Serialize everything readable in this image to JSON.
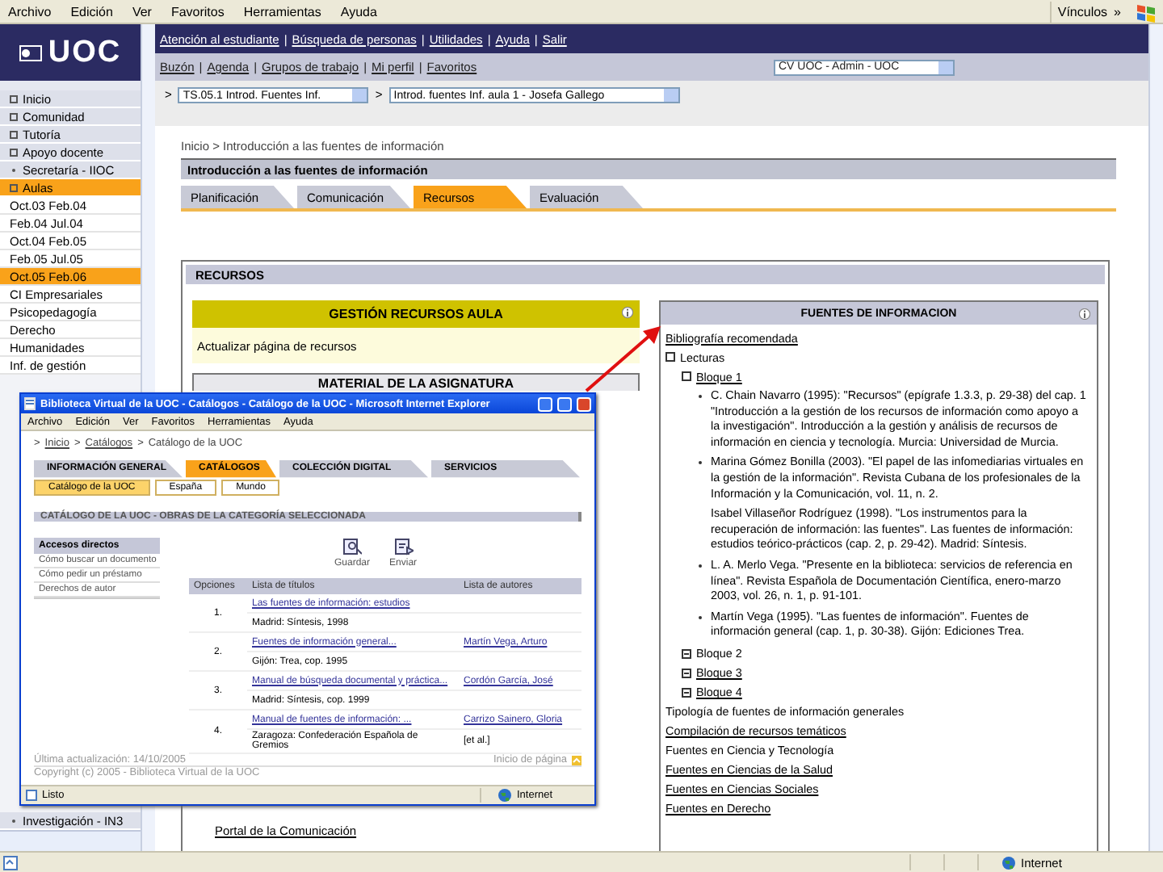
{
  "browser": {
    "menu": [
      "Archivo",
      "Edición",
      "Ver",
      "Favoritos",
      "Herramientas",
      "Ayuda"
    ],
    "links_label": "Vínculos",
    "links_chevron": "»",
    "zone": "Internet"
  },
  "sidebar": {
    "logo": "UOC",
    "items": [
      {
        "label": "Inicio",
        "kind": "section",
        "selected": false
      },
      {
        "label": "Comunidad",
        "kind": "section",
        "selected": false
      },
      {
        "label": "Tutoría",
        "kind": "section",
        "selected": false
      },
      {
        "label": "Apoyo docente",
        "kind": "section",
        "selected": false
      },
      {
        "label": "Secretaría - IIOC",
        "kind": "link",
        "selected": false
      },
      {
        "label": "Aulas",
        "kind": "section",
        "selected": true
      },
      {
        "label": "Oct.03 Feb.04",
        "kind": "term",
        "selected": false
      },
      {
        "label": "Feb.04 Jul.04",
        "kind": "term",
        "selected": false
      },
      {
        "label": "Oct.04 Feb.05",
        "kind": "term",
        "selected": false
      },
      {
        "label": "Feb.05 Jul.05",
        "kind": "term",
        "selected": false
      },
      {
        "label": "Oct.05 Feb.06",
        "kind": "term",
        "selected": true
      },
      {
        "label": "CI Empresariales",
        "kind": "term",
        "selected": false
      },
      {
        "label": "Psicopedagogía",
        "kind": "term",
        "selected": false
      },
      {
        "label": "Derecho",
        "kind": "term",
        "selected": false
      },
      {
        "label": "Humanidades",
        "kind": "term",
        "selected": false
      },
      {
        "label": "Inf. de gestión",
        "kind": "term",
        "selected": false
      }
    ],
    "bottom_item": {
      "label": "Investigación - IN3",
      "kind": "link",
      "selected": false
    }
  },
  "top_links": [
    "Atención al estudiante",
    "Búsqueda de personas",
    "Utilidades",
    "Ayuda",
    "Salir"
  ],
  "secondary_links": [
    "Buzón",
    "Agenda",
    "Grupos de trabajo",
    "Mi perfil",
    "Favoritos"
  ],
  "nav_separator": "|",
  "select_marker": ">",
  "profile_select": "CV UOC - Admin - UOC",
  "course_selects": [
    "TS.05.1 Introd. Fuentes Inf.",
    "Introd. fuentes Inf. aula 1 - Josefa Gallego"
  ],
  "breadcrumb": "Inicio > Introducción a las fuentes de información",
  "course_title": "Introducción a las fuentes de información",
  "tabs": [
    {
      "label": "Planificación",
      "selected": false
    },
    {
      "label": "Comunicación",
      "selected": false
    },
    {
      "label": "Recursos",
      "selected": true
    },
    {
      "label": "Evaluación",
      "selected": false
    }
  ],
  "resources": {
    "title": "RECURSOS",
    "management": {
      "title": "GESTIÓN RECURSOS AULA",
      "link": "Actualizar página de recursos"
    },
    "material": {
      "title": "MATERIAL DE LA ASIGNATURA"
    },
    "bottom_link": "Portal de la Comunicación",
    "sources": {
      "title": "FUENTES DE INFORMACION",
      "tree": [
        {
          "kind": "entry",
          "label": "Bibliografía recomendada",
          "link": true
        },
        {
          "kind": "folder",
          "label": "Lecturas",
          "link": false,
          "expanded": true,
          "children": [
            {
              "kind": "folder",
              "label": "Bloque 1",
              "link": true,
              "expanded": true,
              "children": [
                {
                  "kind": "reference",
                  "bullet": true,
                  "text": "C. Chain Navarro (1995): \"Recursos\" (epígrafe 1.3.3, p. 29-38) del cap. 1 \"Introducción a la gestión de los recursos de información como apoyo a la investigación\". Introducción a la gestión y análisis de recursos de información en ciencia y tecnología. Murcia: Universidad de Murcia."
                },
                {
                  "kind": "reference",
                  "bullet": true,
                  "text": "Marina Gómez Bonilla (2003). \"El papel de las infomediarias virtuales en la gestión de la información\". Revista Cubana de los profesionales de la Información y la Comunicación, vol. 11, n. 2."
                },
                {
                  "kind": "reference",
                  "bullet": false,
                  "text": "Isabel Villaseñor Rodríguez (1998). \"Los instrumentos para la recuperación de información: las fuentes\". Las fuentes de información: estudios teórico-prácticos (cap. 2, p. 29-42). Madrid: Síntesis."
                },
                {
                  "kind": "reference",
                  "bullet": true,
                  "text": "L. A. Merlo Vega. \"Presente en la biblioteca: servicios de referencia en línea\". Revista Española de Documentación Científica, enero-marzo 2003, vol. 26, n. 1, p. 91-101."
                },
                {
                  "kind": "reference",
                  "bullet": true,
                  "text": "Martín Vega (1995). \"Las fuentes de información\". Fuentes de información general (cap. 1, p. 30-38). Gijón: Ediciones Trea."
                }
              ]
            },
            {
              "kind": "folder",
              "label": "Bloque 2",
              "link": false,
              "expanded": false
            },
            {
              "kind": "folder",
              "label": "Bloque 3",
              "link": true,
              "expanded": false
            },
            {
              "kind": "folder",
              "label": "Bloque 4",
              "link": true,
              "expanded": false
            }
          ]
        },
        {
          "kind": "entry",
          "label": "Tipología de fuentes de información generales",
          "link": false
        },
        {
          "kind": "entry",
          "label": "Compilación de recursos temáticos",
          "link": true
        },
        {
          "kind": "entry",
          "label": "Fuentes en Ciencia y Tecnología",
          "link": false
        },
        {
          "kind": "entry",
          "label": "Fuentes en Ciencias de la Salud",
          "link": true
        },
        {
          "kind": "entry",
          "label": "Fuentes en Ciencias Sociales",
          "link": true
        },
        {
          "kind": "entry",
          "label": "Fuentes en Derecho",
          "link": true
        }
      ]
    }
  },
  "popup": {
    "title": "Biblioteca Virtual de la UOC - Catálogos - Catálogo de la UOC - Microsoft Internet Explorer",
    "menu": [
      "Archivo",
      "Edición",
      "Ver",
      "Favoritos",
      "Herramientas",
      "Ayuda"
    ],
    "breadcrumb_separator": ">",
    "breadcrumb": [
      {
        "label": "Inicio",
        "link": true
      },
      {
        "label": "Catálogos",
        "link": true
      },
      {
        "label": "Catálogo de la UOC",
        "link": false
      }
    ],
    "tabs": [
      {
        "label": "INFORMACIÓN GENERAL",
        "selected": false
      },
      {
        "label": "CATÁLOGOS",
        "selected": true
      },
      {
        "label": "COLECCIÓN DIGITAL",
        "selected": false
      },
      {
        "label": "SERVICIOS",
        "selected": false
      }
    ],
    "subtabs": [
      {
        "label": "Catálogo de la UOC",
        "selected": true
      },
      {
        "label": "España",
        "selected": false
      },
      {
        "label": "Mundo",
        "selected": false
      }
    ],
    "section_title": "CATÁLOGO DE LA UOC - OBRAS DE LA CATEGORÍA SELECCIONADA",
    "shortcuts": {
      "title": "Accesos directos",
      "items": [
        "Cómo buscar un documento",
        "Cómo pedir un préstamo",
        "Derechos de autor"
      ]
    },
    "actions": [
      "Guardar",
      "Enviar"
    ],
    "table": {
      "columns": [
        "Opciones",
        "Lista de títulos",
        "Lista de autores"
      ],
      "rows": [
        {
          "number": "1.",
          "title": "Las fuentes de información: estudios",
          "imprint": "Madrid: Síntesis, 1998",
          "authors": []
        },
        {
          "number": "2.",
          "title": "Fuentes de información general...",
          "imprint": "Gijón: Trea, cop. 1995",
          "authors": [
            "Martín Vega, Arturo"
          ]
        },
        {
          "number": "3.",
          "title": "Manual de búsqueda documental y práctica...",
          "imprint": "Madrid: Síntesis, cop. 1999",
          "authors": [
            "Cordón García, José"
          ]
        },
        {
          "number": "4.",
          "title": "Manual de fuentes de información: ...",
          "imprint": "Zaragoza: Confederación Española de Gremios",
          "authors": [
            "Carrizo Sainero, Gloria",
            "[et al.]"
          ]
        }
      ]
    },
    "updated": "Última actualización: 14/10/2005",
    "copyright": "Copyright (c) 2005 - Biblioteca Virtual de la UOC",
    "top_link": "Inicio de página",
    "status": "Listo",
    "zone": "Internet"
  }
}
